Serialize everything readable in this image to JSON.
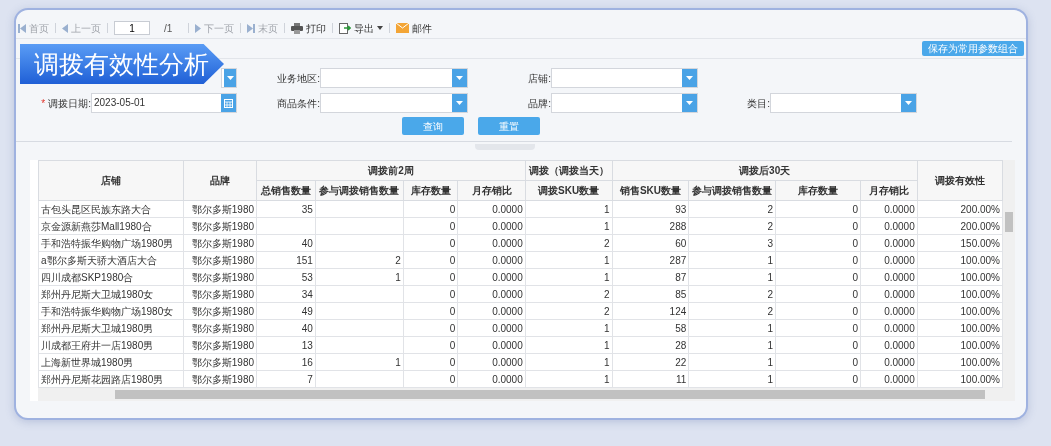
{
  "toolbar": {
    "items": [
      {
        "kind": "first",
        "label": "首页",
        "disabled": true
      },
      {
        "kind": "prev",
        "label": "上一页",
        "disabled": true
      },
      {
        "kind": "page",
        "value": "1",
        "total": "/1"
      },
      {
        "kind": "next",
        "label": "下一页",
        "disabled": true
      },
      {
        "kind": "last",
        "label": "末页",
        "disabled": true
      },
      {
        "kind": "print",
        "label": "打印",
        "disabled": false
      },
      {
        "kind": "export",
        "label": "导出",
        "disabled": false
      },
      {
        "kind": "mail",
        "label": "邮件",
        "disabled": false
      }
    ]
  },
  "banner": {
    "title": "调拨有效性分析"
  },
  "save_button": "保存为常用参数组合",
  "filters": [
    [
      {
        "kind": "select"
      },
      {
        "kind": "select",
        "label": "业务地区:"
      },
      {
        "kind": "select",
        "label": "店铺:"
      }
    ],
    [
      {
        "kind": "date",
        "label": "调拨日期:",
        "required_mark": "*",
        "value": "2023-05-01"
      },
      {
        "kind": "select",
        "label": "商品条件:"
      },
      {
        "kind": "select",
        "label": "品牌:"
      },
      {
        "kind": "select",
        "label": "类目:"
      }
    ]
  ],
  "buttons": [
    "查询",
    "重置"
  ],
  "table": {
    "column_groups": [
      {
        "label": "调拨前2周"
      },
      {
        "label": "调拨（调拨当天）"
      },
      {
        "label": "调拨后30天"
      }
    ],
    "columns": [
      {
        "label": "店铺"
      },
      {
        "label": "品牌"
      },
      {
        "label": "总销售数量"
      },
      {
        "label": "参与调拨销售数量"
      },
      {
        "label": "库存数量"
      },
      {
        "label": "月存销比"
      },
      {
        "label": "调拨SKU数量"
      },
      {
        "label": "销售SKU数量"
      },
      {
        "label": "参与调拨销售数量"
      },
      {
        "label": "库存数量"
      },
      {
        "label": "月存销比"
      },
      {
        "label": "调拨有效性"
      }
    ],
    "rows": [
      [
        "古包头昆区民族东路大合",
        "鄂尔多斯1980",
        "35",
        null,
        "0",
        "0.0000",
        "1",
        "93",
        "2",
        "0",
        "0.0000",
        "200.00%"
      ],
      [
        "京金源新燕莎Mall1980合",
        "鄂尔多斯1980",
        null,
        null,
        "0",
        "0.0000",
        "1",
        "288",
        "2",
        "0",
        "0.0000",
        "200.00%"
      ],
      [
        "手和浩特振华购物广场1980男",
        "鄂尔多斯1980",
        "40",
        null,
        "0",
        "0.0000",
        "2",
        "60",
        "3",
        "0",
        "0.0000",
        "150.00%"
      ],
      [
        "a鄂尔多斯天骄大酒店大合",
        "鄂尔多斯1980",
        "151",
        "2",
        "0",
        "0.0000",
        "1",
        "287",
        "1",
        "0",
        "0.0000",
        "100.00%"
      ],
      [
        "四川成都SKP1980合",
        "鄂尔多斯1980",
        "53",
        "1",
        "0",
        "0.0000",
        "1",
        "87",
        "1",
        "0",
        "0.0000",
        "100.00%"
      ],
      [
        "郑州丹尼斯大卫城1980女",
        "鄂尔多斯1980",
        "34",
        null,
        "0",
        "0.0000",
        "2",
        "85",
        "2",
        "0",
        "0.0000",
        "100.00%"
      ],
      [
        "手和浩特振华购物广场1980女",
        "鄂尔多斯1980",
        "49",
        null,
        "0",
        "0.0000",
        "2",
        "124",
        "2",
        "0",
        "0.0000",
        "100.00%"
      ],
      [
        "郑州丹尼斯大卫城1980男",
        "鄂尔多斯1980",
        "40",
        null,
        "0",
        "0.0000",
        "1",
        "58",
        "1",
        "0",
        "0.0000",
        "100.00%"
      ],
      [
        "川成都王府井一店1980男",
        "鄂尔多斯1980",
        "13",
        null,
        "0",
        "0.0000",
        "1",
        "28",
        "1",
        "0",
        "0.0000",
        "100.00%"
      ],
      [
        "上海新世界城1980男",
        "鄂尔多斯1980",
        "16",
        "1",
        "0",
        "0.0000",
        "1",
        "22",
        "1",
        "0",
        "0.0000",
        "100.00%"
      ],
      [
        "郑州丹尼斯花园路店1980男",
        "鄂尔多斯1980",
        "7",
        null,
        "0",
        "0.0000",
        "1",
        "11",
        "1",
        "0",
        "0.0000",
        "100.00%"
      ]
    ]
  }
}
